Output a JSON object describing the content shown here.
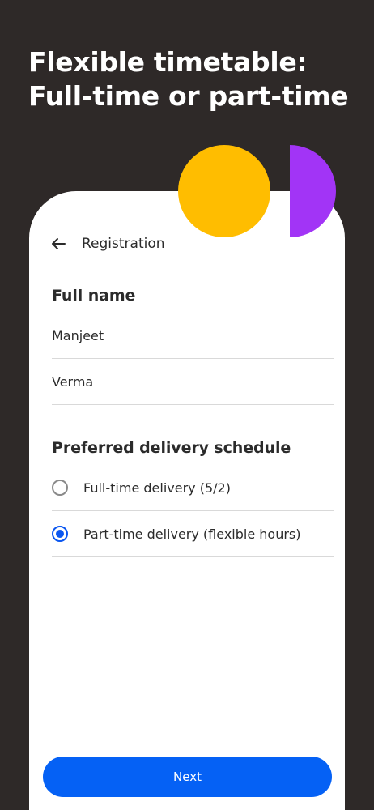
{
  "headline": {
    "line1": "Flexible timetable:",
    "line2": "Full-time or part-time"
  },
  "colors": {
    "background": "#2e2928",
    "accent_blue": "#0561f5",
    "decor_yellow": "#ffbd00",
    "decor_purple": "#a234f6"
  },
  "topbar": {
    "back_icon": "arrow-left-icon",
    "title": "Registration"
  },
  "full_name": {
    "title": "Full name",
    "first_name": "Manjeet",
    "last_name": "Verma"
  },
  "schedule": {
    "title": "Preferred delivery schedule",
    "options": [
      {
        "label": "Full-time delivery (5/2)",
        "selected": false
      },
      {
        "label": "Part-time delivery (flexible hours)",
        "selected": true
      }
    ]
  },
  "next_label": "Next"
}
